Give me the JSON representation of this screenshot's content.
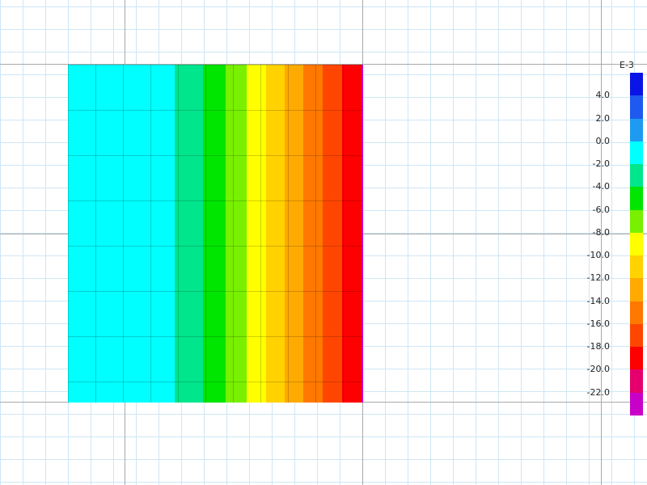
{
  "legend": {
    "title": "E-3",
    "ticks": [
      "4.0",
      "2.0",
      "0.0",
      "-2.0",
      "-4.0",
      "-6.0",
      "-8.0",
      "-10.0",
      "-12.0",
      "-14.0",
      "-16.0",
      "-18.0",
      "-20.0",
      "-22.0"
    ],
    "colors": [
      "#0a14e6",
      "#1e5af0",
      "#1e9bf0",
      "#00ffff",
      "#00e68c",
      "#00e600",
      "#78f000",
      "#ffff00",
      "#ffd200",
      "#ffaa00",
      "#ff7800",
      "#ff4600",
      "#ff0000",
      "#e6006e",
      "#c800c8"
    ]
  },
  "contour": {
    "bands": [
      {
        "color": "#00ffff",
        "weight": 132
      },
      {
        "color": "#00e68c",
        "weight": 35
      },
      {
        "color": "#00e600",
        "weight": 28
      },
      {
        "color": "#78f000",
        "weight": 26
      },
      {
        "color": "#ffff00",
        "weight": 24
      },
      {
        "color": "#ffd200",
        "weight": 23
      },
      {
        "color": "#ffaa00",
        "weight": 23
      },
      {
        "color": "#ff7800",
        "weight": 24
      },
      {
        "color": "#ff4600",
        "weight": 24
      },
      {
        "color": "#ff0000",
        "weight": 24
      },
      {
        "color": "#c800c8",
        "weight": 2
      }
    ]
  }
}
